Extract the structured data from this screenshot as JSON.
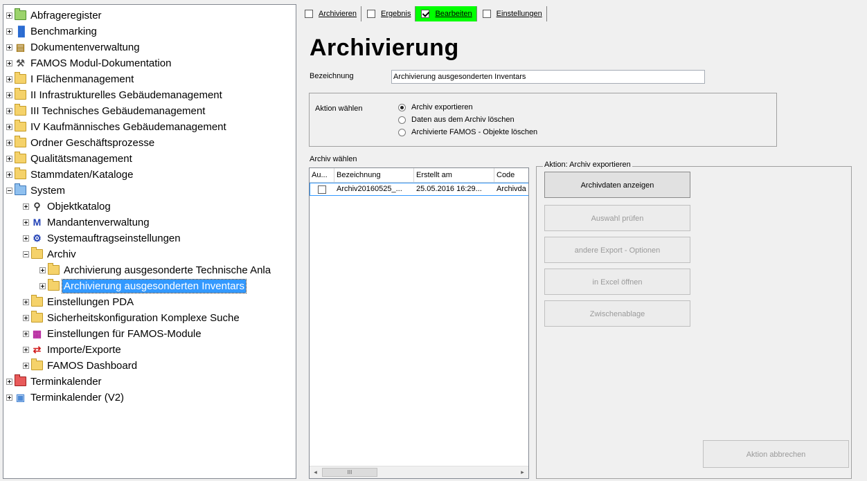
{
  "tree": {
    "items": [
      {
        "label": "Abfrageregister",
        "icon": "folder-green-icon",
        "expander": "plus",
        "level": 0
      },
      {
        "label": "Benchmarking",
        "icon": "benchmark-chart-icon",
        "expander": "plus",
        "level": 0
      },
      {
        "label": "Dokumentenverwaltung",
        "icon": "filing-cabinet-icon",
        "expander": "plus",
        "level": 0
      },
      {
        "label": "FAMOS Modul-Dokumentation",
        "icon": "wrench-icon",
        "expander": "plus",
        "level": 0
      },
      {
        "label": "I  Flächenmanagement",
        "icon": "folder-icon",
        "expander": "plus",
        "level": 0
      },
      {
        "label": "II Infrastrukturelles Gebäudemanagement",
        "icon": "folder-icon",
        "expander": "plus",
        "level": 0
      },
      {
        "label": "III Technisches Gebäudemanagement",
        "icon": "folder-icon",
        "expander": "plus",
        "level": 0
      },
      {
        "label": "IV Kaufmännisches Gebäudemanagement",
        "icon": "folder-icon",
        "expander": "plus",
        "level": 0
      },
      {
        "label": "Ordner Geschäftsprozesse",
        "icon": "folder-icon",
        "expander": "plus",
        "level": 0
      },
      {
        "label": "Qualitätsmanagement",
        "icon": "folder-icon",
        "expander": "plus",
        "level": 0
      },
      {
        "label": "Stammdaten/Kataloge",
        "icon": "folder-icon",
        "expander": "plus",
        "level": 0
      },
      {
        "label": "System",
        "icon": "folder-blue-icon",
        "expander": "minus",
        "level": 0
      },
      {
        "label": "Objektkatalog",
        "icon": "object-tree-icon",
        "expander": "plus",
        "level": 1
      },
      {
        "label": "Mandantenverwaltung",
        "icon": "m-letter-icon",
        "expander": "plus",
        "level": 1
      },
      {
        "label": "Systemauftragseinstellungen",
        "icon": "settings-gear-icon",
        "expander": "plus",
        "level": 1
      },
      {
        "label": "Archiv",
        "icon": "folder-icon",
        "expander": "minus",
        "level": 1
      },
      {
        "label": "Archivierung ausgesonderte Technische Anla",
        "icon": "folder-icon",
        "expander": "plus",
        "level": 2
      },
      {
        "label": "Archivierung ausgesonderten Inventars",
        "icon": "folder-icon",
        "expander": "plus",
        "level": 2,
        "selected": true
      },
      {
        "label": "Einstellungen PDA",
        "icon": "folder-icon",
        "expander": "plus",
        "level": 1
      },
      {
        "label": "Sicherheitskonfiguration Komplexe Suche",
        "icon": "folder-icon",
        "expander": "plus",
        "level": 1
      },
      {
        "label": "Einstellungen für FAMOS-Module",
        "icon": "module-settings-icon",
        "expander": "plus",
        "level": 1
      },
      {
        "label": "Importe/Exporte",
        "icon": "import-export-icon",
        "expander": "plus",
        "level": 1
      },
      {
        "label": "FAMOS Dashboard",
        "icon": "folder-icon",
        "expander": "plus",
        "level": 1
      },
      {
        "label": "Terminkalender",
        "icon": "folder-red-icon",
        "expander": "plus",
        "level": 0
      },
      {
        "label": "Terminkalender (V2)",
        "icon": "calendar-icon",
        "expander": "plus",
        "level": 0
      }
    ]
  },
  "tabs": [
    {
      "label": "Archivieren",
      "checked": false
    },
    {
      "label": "Ergebnis",
      "checked": false
    },
    {
      "label": "Bearbeiten",
      "checked": true
    },
    {
      "label": "Einstellungen",
      "checked": false
    }
  ],
  "page": {
    "title": "Archivierung",
    "bezeichnung_label": "Bezeichnung",
    "bezeichnung_value": "Archivierung ausgesonderten Inventars"
  },
  "aktion": {
    "label": "Aktion wählen",
    "options": [
      {
        "label": "Archiv exportieren",
        "checked": true
      },
      {
        "label": "Daten aus dem Archiv löschen",
        "checked": false
      },
      {
        "label": "Archivierte FAMOS - Objekte löschen",
        "checked": false
      }
    ]
  },
  "archiv": {
    "label": "Archiv wählen",
    "columns": [
      "Au...",
      "Bezeichnung",
      "Erstellt am",
      "Code"
    ],
    "rows": [
      {
        "checked": false,
        "bezeichnung": "Archiv20160525_...",
        "erstellt": "25.05.2016 16:29...",
        "code": "Archivda"
      }
    ],
    "scroll_left": "◂",
    "scroll_thumb": "III",
    "scroll_right": "▸"
  },
  "group": {
    "title": "Aktion: Archiv exportieren",
    "buttons": [
      {
        "label": "Archivdaten anzeigen",
        "enabled": true
      },
      {
        "label": "Auswahl prüfen",
        "enabled": false
      },
      {
        "label": "andere Export - Optionen",
        "enabled": false
      },
      {
        "label": "in Excel öffnen",
        "enabled": false
      },
      {
        "label": "Zwischenablage",
        "enabled": false
      }
    ],
    "cancel_label": "Aktion abbrechen"
  },
  "colors": {
    "active_tab": "#00ff00",
    "selection": "#3399ff"
  }
}
